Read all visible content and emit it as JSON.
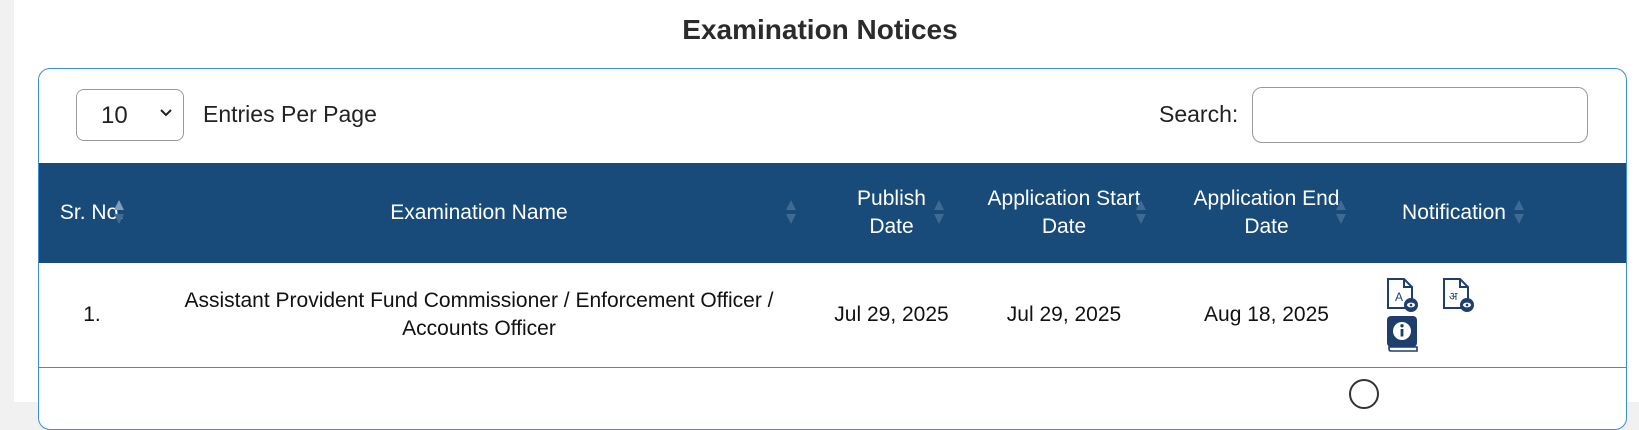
{
  "page": {
    "title": "Examination Notices"
  },
  "controls": {
    "entries_value": "10",
    "entries_label": "Entries Per Page",
    "search_label": "Search:",
    "search_value": ""
  },
  "table": {
    "headers": {
      "sr": "Sr. No.",
      "name": "Examination Name",
      "publish": "Publish Date",
      "app_start": "Application Start Date",
      "app_end": "Application End Date",
      "notification": "Notification"
    },
    "rows": [
      {
        "sr": "1.",
        "name": "Assistant Provident Fund Commissioner / Enforcement Officer / Accounts Officer",
        "publish": "Jul 29, 2025",
        "app_start": "Jul 29, 2025",
        "app_end": "Aug 18, 2025",
        "doc_english_letter": "A",
        "doc_hindi_letter": "अ"
      }
    ]
  },
  "colors": {
    "header_bg": "#184b7a",
    "border": "#3a8fd6",
    "icon": "#1e3f6e"
  },
  "icons": [
    "chevron-down-icon",
    "sort-icon",
    "english-notice-icon",
    "hindi-notice-icon",
    "info-book-icon"
  ]
}
